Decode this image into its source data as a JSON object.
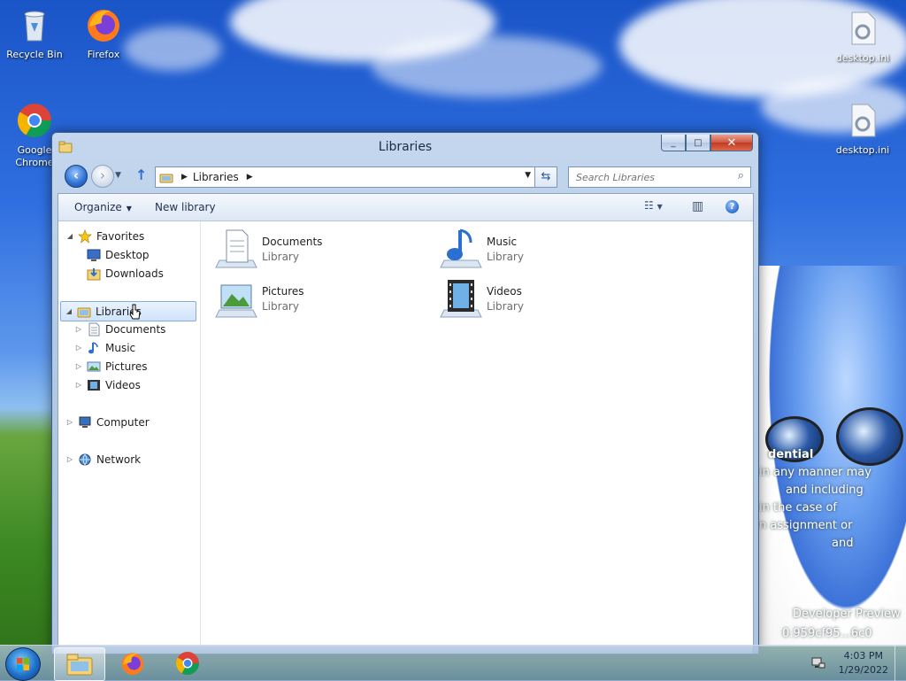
{
  "desktop": {
    "icons": [
      {
        "label": "Recycle Bin"
      },
      {
        "label": "Firefox"
      },
      {
        "label": "Google Chrome"
      },
      {
        "label": "desktop.ini"
      },
      {
        "label": "desktop.ini"
      }
    ],
    "wallpaper_text": [
      "dential",
      "in any manner may",
      "and including",
      "in the case of",
      "n assignment or",
      "and",
      "Developer Preview",
      "0.959cf95...6c0"
    ]
  },
  "window": {
    "title": "Libraries",
    "caption": {
      "minimize": "_",
      "maximize": "□",
      "close": "✕"
    },
    "address": {
      "crumbs": [
        "Libraries"
      ]
    },
    "search": {
      "placeholder": "Search Libraries"
    },
    "commands": {
      "organize": "Organize",
      "new_library": "New library"
    },
    "nav_tree": [
      {
        "label": "Favorites",
        "icon": "star-icon"
      },
      {
        "label": "Desktop",
        "icon": "desktop-icon"
      },
      {
        "label": "Downloads",
        "icon": "downloads-icon"
      },
      {
        "label": "Libraries",
        "icon": "libraries-icon",
        "selected": true
      },
      {
        "label": "Documents",
        "icon": "documents-icon"
      },
      {
        "label": "Music",
        "icon": "music-icon"
      },
      {
        "label": "Pictures",
        "icon": "pictures-icon"
      },
      {
        "label": "Videos",
        "icon": "videos-icon"
      },
      {
        "label": "Computer",
        "icon": "computer-icon"
      },
      {
        "label": "Network",
        "icon": "network-icon"
      }
    ],
    "libraries": [
      {
        "name": "Documents",
        "type": "Library",
        "icon": "documents-library-icon"
      },
      {
        "name": "Music",
        "type": "Library",
        "icon": "music-library-icon"
      },
      {
        "name": "Pictures",
        "type": "Library",
        "icon": "pictures-library-icon"
      },
      {
        "name": "Videos",
        "type": "Library",
        "icon": "videos-library-icon"
      }
    ]
  },
  "taskbar": {
    "pinned": [
      "Windows Explorer",
      "Firefox",
      "Google Chrome"
    ],
    "clock": {
      "time": "4:03 PM",
      "date": "1/29/2022"
    }
  },
  "colors": {
    "accent": "#2b6fd1",
    "window_frame": "#b3cae6",
    "close_button": "#c0391f",
    "selection": "#cfe3fb"
  }
}
